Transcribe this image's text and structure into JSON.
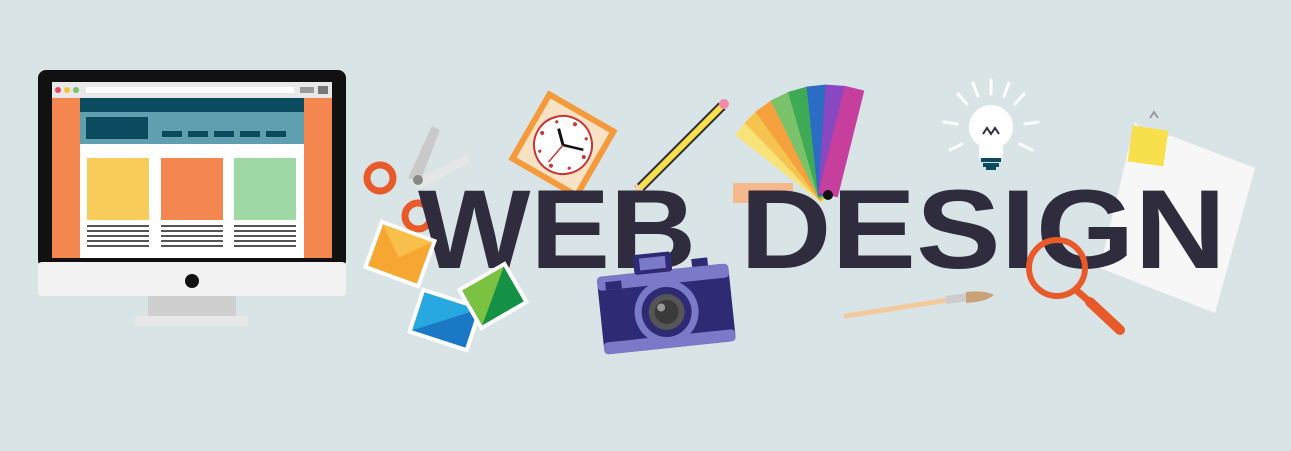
{
  "banner": {
    "title_word_1": "WEB",
    "title_word_2": "DESIGN"
  },
  "colors": {
    "background": "#d9e4e7",
    "title": "#2e2c3d",
    "accent_orange": "#f4874f",
    "accent_navy": "#0b4b5f",
    "accent_teal": "#5f9fb0",
    "card_yellow": "#f8cc5b",
    "card_orange": "#f4874f",
    "card_green": "#9ed8a4",
    "camera_body": "#2e2a73",
    "camera_trim": "#7b7ac8",
    "magnifier": "#e85a2a",
    "note_yellow": "#f7e04b"
  },
  "icons": [
    "desktop-monitor-icon",
    "scissors-icon",
    "clock-icon",
    "pencil-icon",
    "color-swatch-fan-icon",
    "light-bulb-icon",
    "sticky-note-icon",
    "photo-cards-icon",
    "camera-icon",
    "paint-brush-icon",
    "magnifying-glass-icon"
  ]
}
